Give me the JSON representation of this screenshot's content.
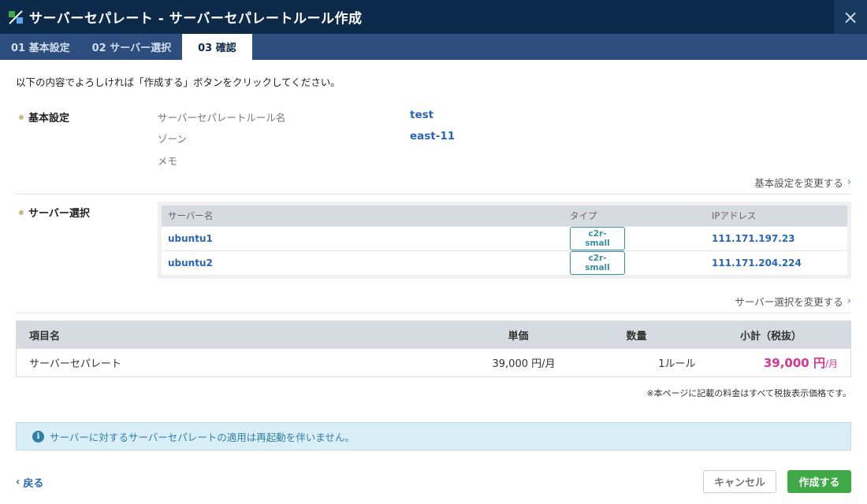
{
  "window": {
    "title": "サーバーセパレート - サーバーセパレートルール作成",
    "close_icon": "×",
    "colors": {
      "titlebar": "#0e2a4a",
      "stepbar": "#2c4d7d",
      "accent": "#2a66b8",
      "price": "#d6368f",
      "create_button": "#3daa47"
    }
  },
  "steps": [
    {
      "label": "01 基本設定",
      "active": false
    },
    {
      "label": "02 サーバー選択",
      "active": false
    },
    {
      "label": "03 確認",
      "active": true
    }
  ],
  "intro": "以下の内容でよろしければ「作成する」ボタンをクリックしてください。",
  "basic": {
    "section_label": "基本設定",
    "rule_name_label": "サーバーセパレートルール名",
    "rule_name_value": "test",
    "zone_label": "ゾーン",
    "zone_value": "east-11",
    "memo_label": "メモ",
    "memo_value": "",
    "change_link": "基本設定を変更する"
  },
  "servers": {
    "section_label": "サーバー選択",
    "columns": [
      "サーバー名",
      "タイプ",
      "IPアドレス"
    ],
    "rows": [
      {
        "name": "ubuntu1",
        "type": "c2r-small",
        "ip": "111.171.197.23"
      },
      {
        "name": "ubuntu2",
        "type": "c2r-small",
        "ip": "111.171.204.224"
      }
    ],
    "change_link": "サーバー選択を変更する"
  },
  "pricing": {
    "columns": [
      "項目名",
      "単価",
      "数量",
      "小計（税抜）"
    ],
    "row": {
      "item": "サーバーセパレート",
      "unit_price": "39,000 円/月",
      "quantity": "1ルール",
      "subtotal": "39,000 円",
      "subtotal_unit": "/月"
    },
    "tax_note": "※本ページに記載の料金はすべて税抜表示価格です。"
  },
  "info": {
    "icon": "info-icon",
    "text": "サーバーに対するサーバーセパレートの適用は再起動を伴いません。"
  },
  "footer": {
    "back_label": "戻る",
    "cancel_label": "キャンセル",
    "create_label": "作成する"
  }
}
